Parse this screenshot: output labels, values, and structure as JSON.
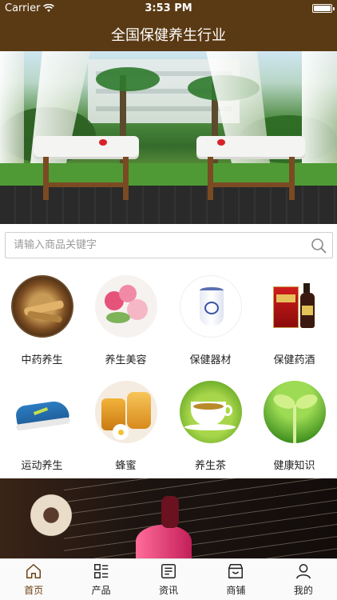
{
  "status": {
    "carrier": "Carrier",
    "time": "3:53 PM"
  },
  "header": {
    "title": "全国保健养生行业"
  },
  "banner": {
    "slide_count": 3,
    "active_slide": 3,
    "accent": "#d42a1f"
  },
  "search": {
    "placeholder": "请输入商品关键字"
  },
  "categories": [
    {
      "label": "中药养生",
      "icon": "herbal-medicine-image"
    },
    {
      "label": "养生美容",
      "icon": "flower-beauty-image"
    },
    {
      "label": "保健器材",
      "icon": "porcelain-jar-image"
    },
    {
      "label": "保健药酒",
      "icon": "medicinal-wine-image"
    },
    {
      "label": "运动养生",
      "icon": "sneaker-image"
    },
    {
      "label": "蜂蜜",
      "icon": "honey-jar-image"
    },
    {
      "label": "养生茶",
      "icon": "tea-cup-image"
    },
    {
      "label": "健康知识",
      "icon": "sprout-image"
    }
  ],
  "tabbar": {
    "active_color": "#6b4112",
    "items": [
      {
        "label": "首页",
        "icon": "home-icon"
      },
      {
        "label": "产品",
        "icon": "product-grid-icon"
      },
      {
        "label": "资讯",
        "icon": "news-icon"
      },
      {
        "label": "商铺",
        "icon": "store-icon"
      },
      {
        "label": "我的",
        "icon": "user-icon"
      }
    ]
  },
  "colors": {
    "header_bg": "#5a3a14"
  }
}
